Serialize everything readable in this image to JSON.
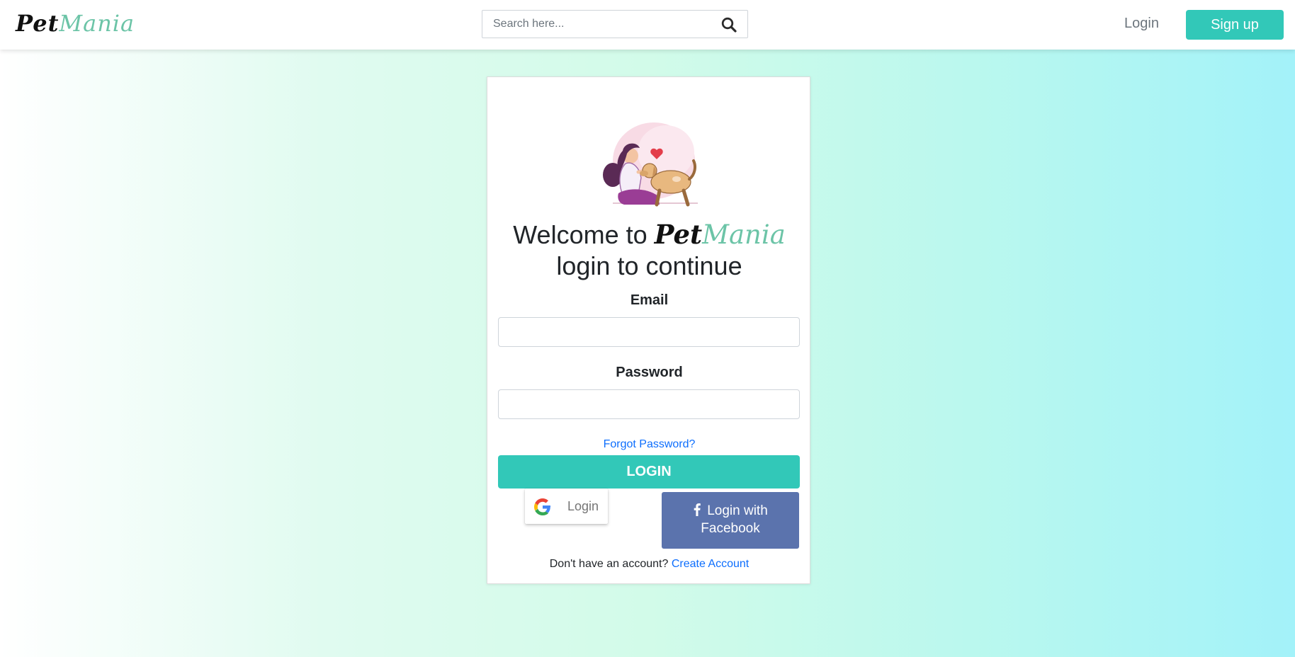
{
  "navbar": {
    "logo_part1": "Pet",
    "logo_part2": "Mania",
    "search_placeholder": "Search here...",
    "login_label": "Login",
    "signup_label": "Sign up"
  },
  "card": {
    "welcome_prefix": "Welcome to",
    "brand_part1": "Pet",
    "brand_part2": "Mania",
    "subtitle": "login to continue",
    "email_label": "Email",
    "email_value": "",
    "password_label": "Password",
    "password_value": "",
    "forgot_label": "Forgot Password?",
    "login_button": "LOGIN",
    "google_login_label": "Login",
    "facebook_login_label": "Login with Facebook",
    "no_account_text": "Don't have an account?",
    "create_account_label": "Create Account"
  },
  "colors": {
    "accent": "#32c8b8",
    "brand_green": "#6cc4a7",
    "link": "#0d6efd",
    "facebook": "#5b73ad"
  },
  "icons": {
    "search": "search-icon",
    "google": "google-icon",
    "facebook": "facebook-icon"
  }
}
